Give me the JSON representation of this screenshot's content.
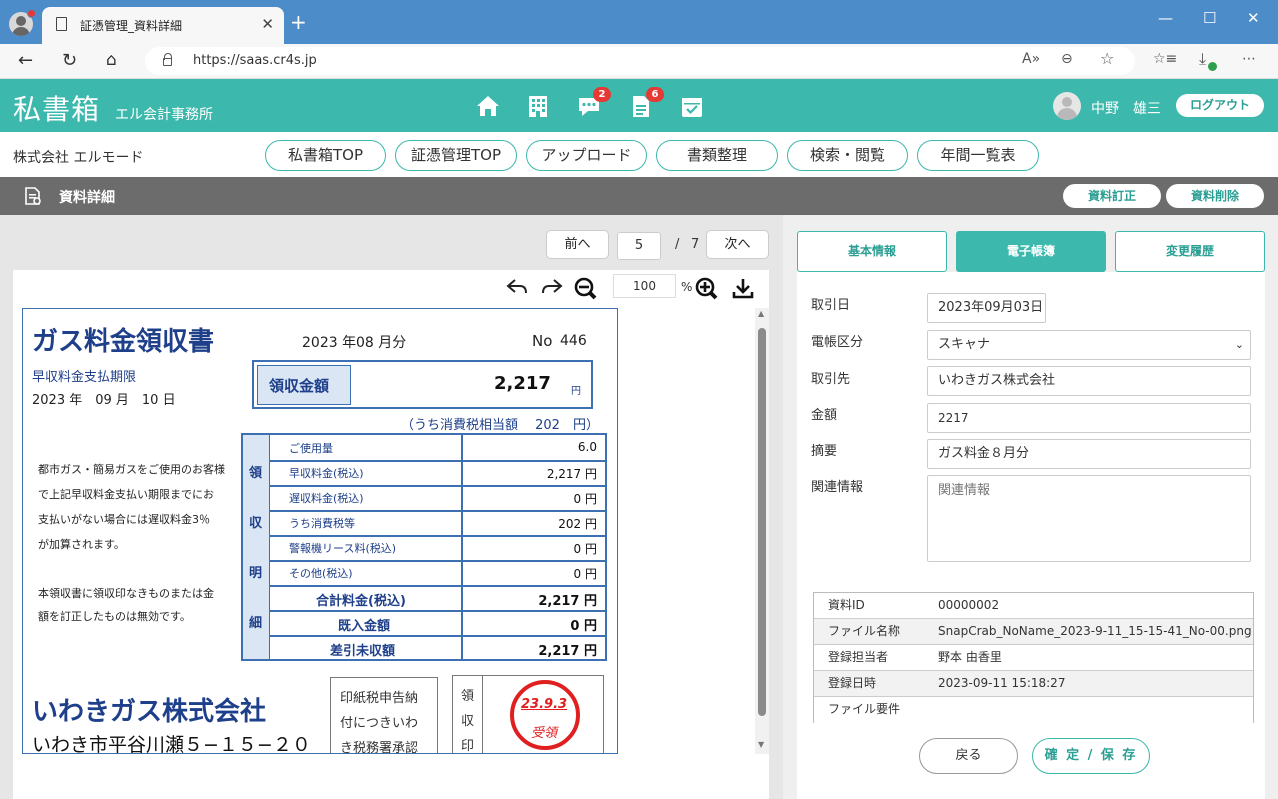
{
  "browser": {
    "tab_title": "証憑管理_資料詳細",
    "url": "https://saas.cr4s.jp",
    "new_tab": "+",
    "close_tab": "✕"
  },
  "header": {
    "logo": "私書箱",
    "firm": "エル会計事務所",
    "chat_badge": "2",
    "doc_badge": "6",
    "username": "中野　雄三",
    "logout": "ログアウト"
  },
  "company": "株式会社 エルモード",
  "nav": [
    "私書箱TOP",
    "証憑管理TOP",
    "アップロード",
    "書類整理",
    "検索・閲覧",
    "年間一覧表"
  ],
  "page": {
    "title": "資料詳細",
    "correct_btn": "資料訂正",
    "delete_btn": "資料削除"
  },
  "viewer": {
    "prev": "前へ",
    "next": "次へ",
    "page": "5",
    "sep": "/",
    "total": "7",
    "zoom": "100",
    "zoom_unit": "%"
  },
  "receipt": {
    "title": "ガス料金領収書",
    "year": "2023 年",
    "month": "08 月分",
    "no_label": "No",
    "no": "446",
    "due_label": "早収料金支払期限",
    "due_date": "2023 年　09 月　10 日",
    "amount_label": "領収金額",
    "amount": "2,217",
    "yen": "円",
    "tax_note": "（うち消費税相当額　 202　円）",
    "note1": [
      "都市ガス・簡易ガスをご使用のお客様",
      "で上記早収料金支払い期限までにお",
      "支払いがない場合には遅収料金3％",
      "が加算されます。"
    ],
    "note2": [
      "本領収書に領収印なきものまたは金",
      "額を訂正したものは無効です。"
    ],
    "side_chars": [
      "領",
      "収",
      "明",
      "細"
    ],
    "rows": [
      {
        "label": "ご使用量",
        "value": "6.0"
      },
      {
        "label": "早収料金(税込)",
        "value": "2,217 円"
      },
      {
        "label": "遅収料金(税込)",
        "value": "0 円"
      },
      {
        "label": "うち消費税等",
        "value": "202 円"
      },
      {
        "label": "警報機リース料(税込)",
        "value": "0 円"
      },
      {
        "label": "その他(税込)",
        "value": "0 円"
      },
      {
        "label": "合計料金(税込)",
        "value": "2,217 円"
      },
      {
        "label": "既入金額",
        "value": "0 円"
      },
      {
        "label": "差引未収額",
        "value": "2,217 円"
      }
    ],
    "company": "いわきガス株式会社",
    "address": "いわき市平谷川瀬５−１５−２０",
    "stamp_note": [
      "印紙税申告納",
      "付につきいわ",
      "き税務署承認"
    ],
    "receipt_stamp_chars": [
      "領",
      "収",
      "印"
    ],
    "stamp_date": "23.9.3",
    "stamp_text": "受領"
  },
  "right": {
    "tabs": [
      "基本情報",
      "電子帳簿",
      "変更履歴"
    ],
    "active_tab": "電子帳簿",
    "fields": {
      "date_label": "取引日",
      "date": "2023年09月03日",
      "category_label": "電帳区分",
      "category": "スキャナ",
      "partner_label": "取引先",
      "partner": "いわきガス株式会社",
      "amount_label": "金額",
      "amount": "2217",
      "summary_label": "摘要",
      "summary": "ガス料金８月分",
      "related_label": "関連情報",
      "related_placeholder": "関連情報"
    },
    "info": [
      {
        "k": "資料ID",
        "v": "00000002"
      },
      {
        "k": "ファイル名称",
        "v": "SnapCrab_NoName_2023-9-11_15-15-41_No-00.png"
      },
      {
        "k": "登録担当者",
        "v": "野本 由香里"
      },
      {
        "k": "登録日時",
        "v": "2023-09-11 15:18:27"
      },
      {
        "k": "ファイル要件",
        "v": ""
      }
    ],
    "back": "戻る",
    "save": "確 定 / 保 存"
  },
  "colors": {
    "teal": "#3cb8ad",
    "receipt_blue": "#1e3f8a",
    "stamp_red": "#e02020"
  }
}
